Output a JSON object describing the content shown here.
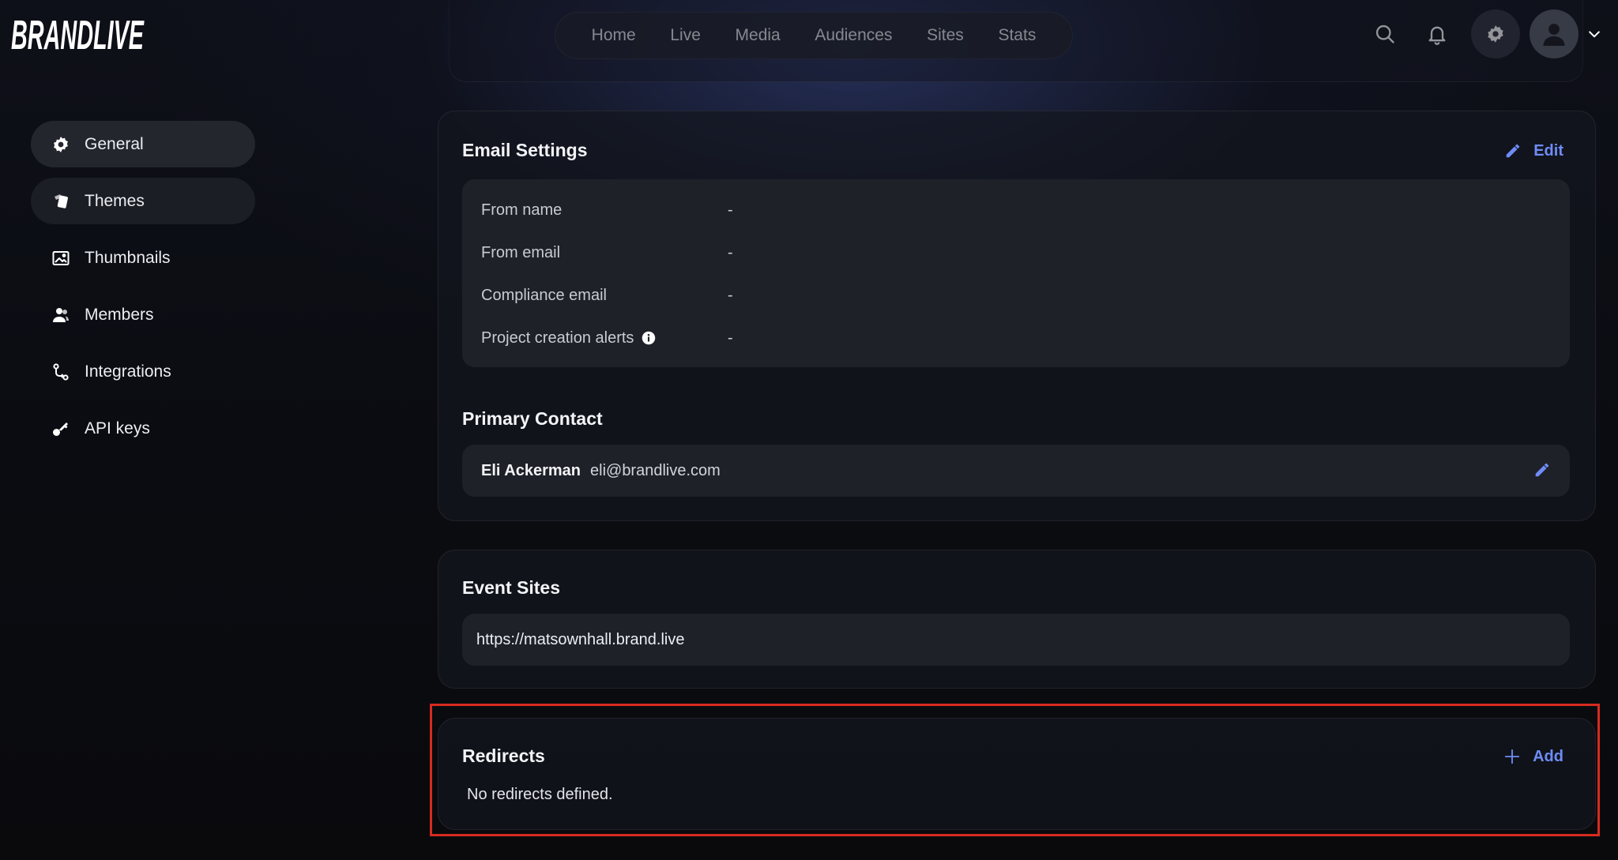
{
  "brand": {
    "logo_text": "BRANDLIVE"
  },
  "top_nav": [
    {
      "label": "Home"
    },
    {
      "label": "Live"
    },
    {
      "label": "Media"
    },
    {
      "label": "Audiences"
    },
    {
      "label": "Sites"
    },
    {
      "label": "Stats"
    }
  ],
  "header_icons": [
    "search-icon",
    "bell-icon",
    "gear-icon",
    "user-icon",
    "chevron-down-icon"
  ],
  "sidebar": {
    "items": [
      {
        "label": "General",
        "icon": "gear-icon",
        "state": "active"
      },
      {
        "label": "Themes",
        "icon": "theme-icon",
        "state": "hover"
      },
      {
        "label": "Thumbnails",
        "icon": "image-icon",
        "state": ""
      },
      {
        "label": "Members",
        "icon": "users-icon",
        "state": ""
      },
      {
        "label": "Integrations",
        "icon": "integration-icon",
        "state": ""
      },
      {
        "label": "API keys",
        "icon": "key-icon",
        "state": ""
      }
    ]
  },
  "email_settings": {
    "title": "Email Settings",
    "edit_label": "Edit",
    "rows": [
      {
        "label": "From name",
        "value": "-"
      },
      {
        "label": "From email",
        "value": "-"
      },
      {
        "label": "Compliance email",
        "value": "-"
      },
      {
        "label": "Project creation alerts",
        "value": "-"
      }
    ],
    "primary_contact_title": "Primary Contact",
    "contact_name": "Eli Ackerman",
    "contact_email": "eli@brandlive.com"
  },
  "event_sites": {
    "title": "Event Sites",
    "url": "https://matsownhall.brand.live"
  },
  "redirects": {
    "title": "Redirects",
    "add_label": "Add",
    "empty_text": "No redirects defined."
  },
  "colors": {
    "accent": "#6f8cf6",
    "highlight": "#d62b1f",
    "card_bg": "#14161e",
    "inner_bg": "#1f2129"
  }
}
